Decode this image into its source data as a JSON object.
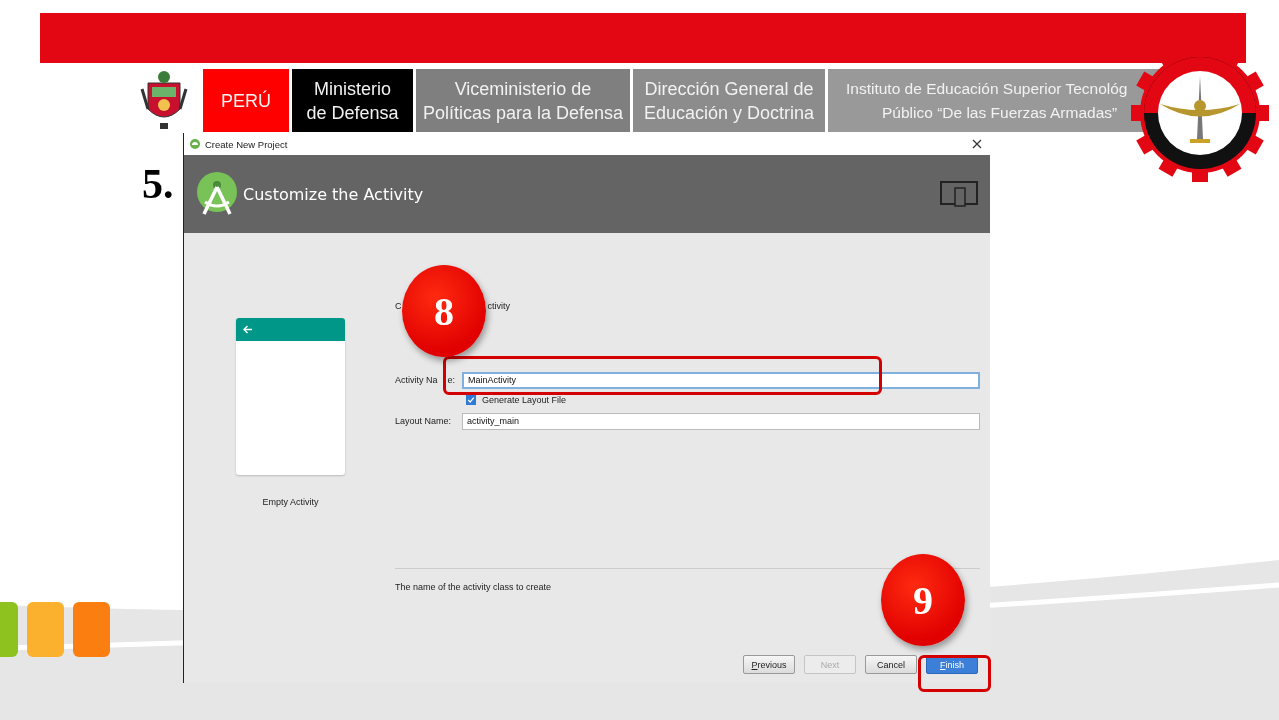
{
  "slide": {
    "step_number": "5.",
    "header_boxes": [
      {
        "lines": [
          "PERÚ"
        ],
        "color": "#ff0000"
      },
      {
        "lines": [
          "Ministerio",
          "de Defensa"
        ],
        "color": "#000000"
      },
      {
        "lines": [
          "Viceministerio de",
          "Políticas para la Defensa"
        ],
        "color": "#7f7f7f"
      },
      {
        "lines": [
          "Dirección General de",
          "Educación y Doctrina"
        ],
        "color": "#8c8c8c"
      },
      {
        "lines": [
          "Instituto de Educación Superior Tecnológ",
          "Público “De las Fuerzas Armadas”"
        ],
        "color": "#999999"
      }
    ]
  },
  "dialog": {
    "title": "Create New Project",
    "header_title": "Customize the Activity",
    "template": {
      "name": "Empty Activity"
    },
    "description_parts": [
      "C",
      "ctivity"
    ],
    "fields": [
      {
        "label_parts": [
          "Activity Na",
          "e:"
        ],
        "value": "MainActivity",
        "focused": true
      },
      {
        "label_parts": [
          "Layout Name:"
        ],
        "value": "activity_main",
        "focused": false
      }
    ],
    "checkbox": {
      "label": "Generate Layout File",
      "checked": true
    },
    "help_text": "The name of the activity class to create",
    "buttons": [
      {
        "label": "Previous",
        "mnemonic": true,
        "disabled": false,
        "default": false
      },
      {
        "label": "Next",
        "mnemonic": false,
        "disabled": true,
        "default": false
      },
      {
        "label": "Cancel",
        "mnemonic": false,
        "disabled": false,
        "default": false
      },
      {
        "label": "Finish",
        "mnemonic": true,
        "disabled": false,
        "default": true
      }
    ]
  },
  "callouts": [
    {
      "number": "8"
    },
    {
      "number": "9"
    }
  ]
}
